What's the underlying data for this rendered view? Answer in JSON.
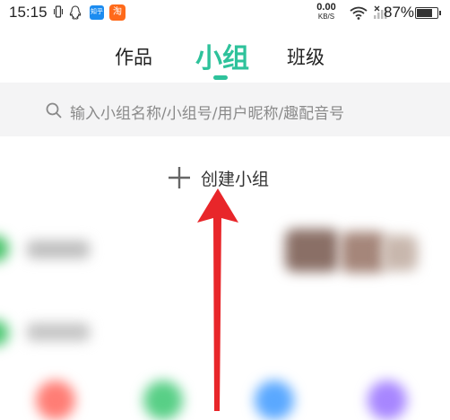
{
  "status_bar": {
    "time": "15:15",
    "zhihu_label": "知乎",
    "taobao_label": "淘",
    "net_speed_value": "0.00",
    "net_speed_unit": "KB/S",
    "battery_percent": "87%",
    "battery_level": 0.87
  },
  "tabs": [
    {
      "label": "作品"
    },
    {
      "label": "小组",
      "active": true
    },
    {
      "label": "班级"
    }
  ],
  "search": {
    "placeholder": "输入小组名称/小组号/用户昵称/趣配音号"
  },
  "create_group": {
    "label": "创建小组"
  },
  "colors": {
    "accent": "#2ec29b",
    "annotation_arrow": "#e8262a",
    "search_bg": "#f4f4f5"
  }
}
